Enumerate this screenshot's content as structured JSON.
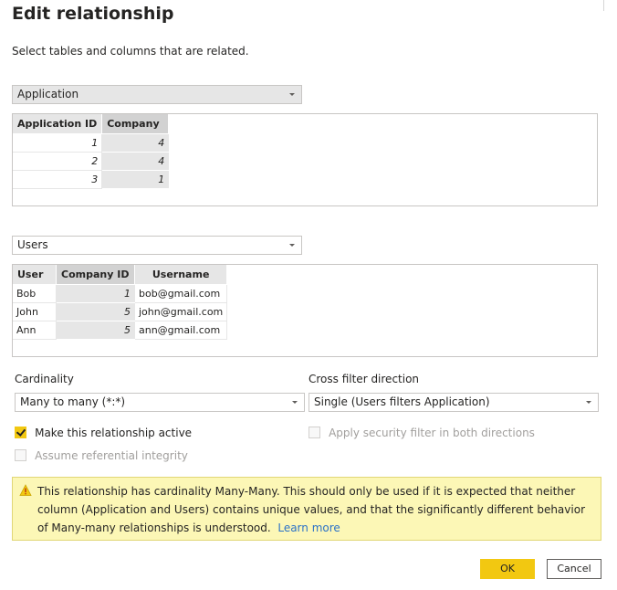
{
  "dialog": {
    "title": "Edit relationship",
    "subtitle": "Select tables and columns that are related."
  },
  "table1": {
    "selected": "Application",
    "columns": [
      "Application ID",
      "Company"
    ],
    "rows": [
      [
        "1",
        "4"
      ],
      [
        "2",
        "4"
      ],
      [
        "3",
        "1"
      ]
    ]
  },
  "table2": {
    "selected": "Users",
    "columns": [
      "User",
      "Company ID",
      "Username"
    ],
    "rows": [
      [
        "Bob",
        "1",
        "bob@gmail.com"
      ],
      [
        "John",
        "5",
        "john@gmail.com"
      ],
      [
        "Ann",
        "5",
        "ann@gmail.com"
      ]
    ]
  },
  "cardinality": {
    "label": "Cardinality",
    "selected": "Many to many (*:*)"
  },
  "cross_filter": {
    "label": "Cross filter direction",
    "selected": "Single (Users filters Application)"
  },
  "options": {
    "active_label": "Make this relationship active",
    "active_checked": true,
    "security_label": "Apply security filter in both directions",
    "referential_label": "Assume referential integrity"
  },
  "warning": {
    "text": "This relationship has cardinality Many-Many. This should only be used if it is expected that neither column (Application and Users) contains unique values, and that the significantly different behavior of Many-many relationships is understood.",
    "link": "Learn more",
    "icon": "warning-icon",
    "background": "#fcf7b6"
  },
  "buttons": {
    "ok": "OK",
    "cancel": "Cancel"
  },
  "colors": {
    "accent": "#f2c811",
    "link": "#2b72c7",
    "key_column": "#e6e6e6"
  }
}
